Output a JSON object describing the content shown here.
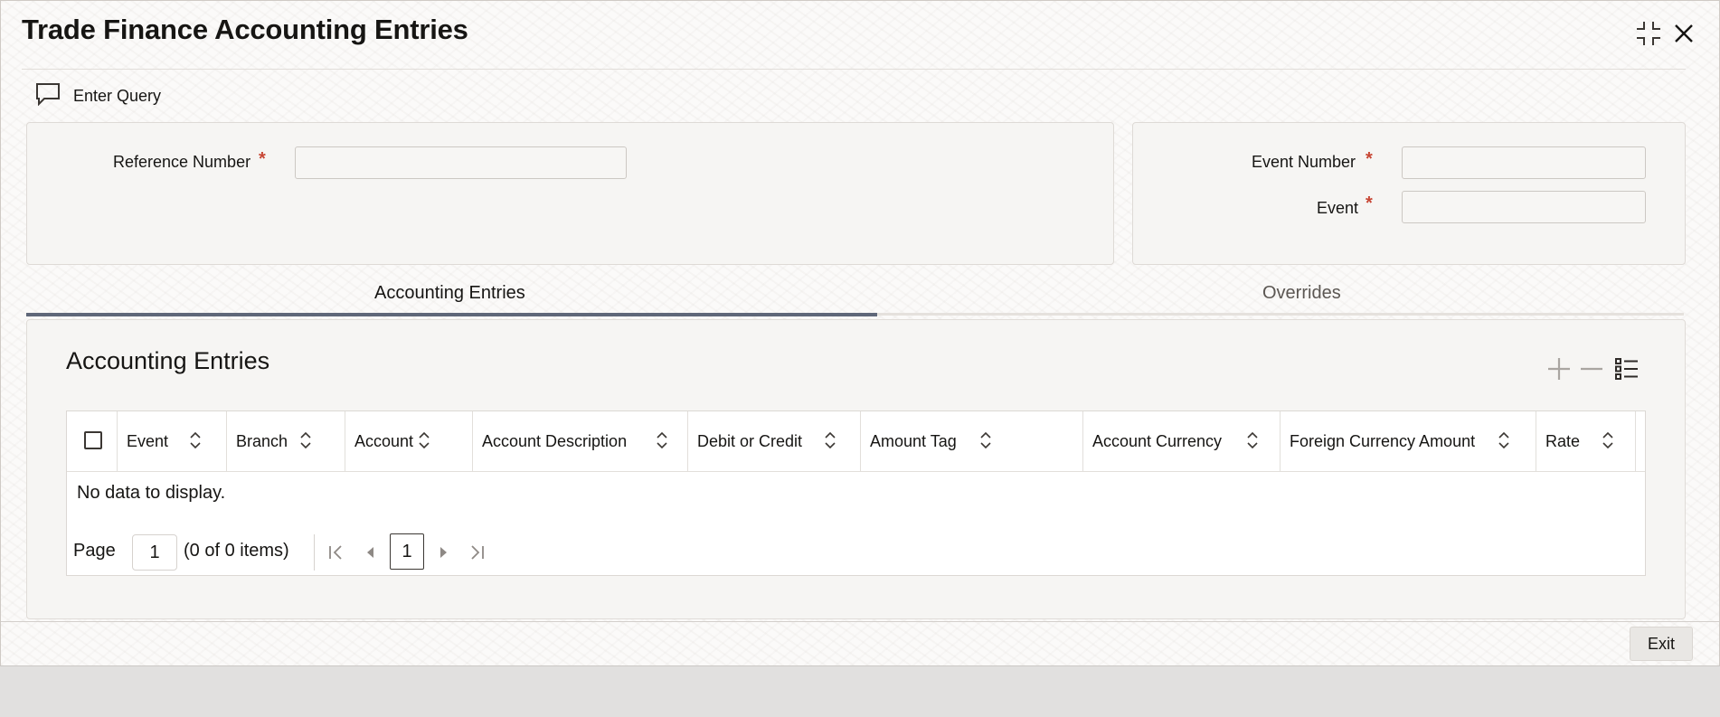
{
  "window": {
    "title": "Trade Finance Accounting Entries"
  },
  "toolbar": {
    "enter_query_label": "Enter Query"
  },
  "header_fields": {
    "reference_number": {
      "label": "Reference Number",
      "required_mark": "*",
      "value": ""
    },
    "event_number": {
      "label": "Event Number",
      "required_mark": "*",
      "value": ""
    },
    "event": {
      "label": "Event",
      "required_mark": "*",
      "value": ""
    }
  },
  "tabs": [
    {
      "label": "Accounting Entries",
      "active": true
    },
    {
      "label": "Overrides",
      "active": false
    }
  ],
  "grid": {
    "title": "Accounting Entries",
    "columns": [
      "Event",
      "Branch",
      "Account",
      "Account Description",
      "Debit or Credit",
      "Amount Tag",
      "Account Currency",
      "Foreign Currency Amount",
      "Rate"
    ],
    "empty_message": "No data to display.",
    "pagination": {
      "page_label": "Page",
      "page_value": "1",
      "items_summary": "(0 of 0 items)",
      "current_page": "1"
    }
  },
  "footer": {
    "exit_label": "Exit"
  },
  "colors": {
    "accent": "#5f6779",
    "required": "#c74634"
  }
}
